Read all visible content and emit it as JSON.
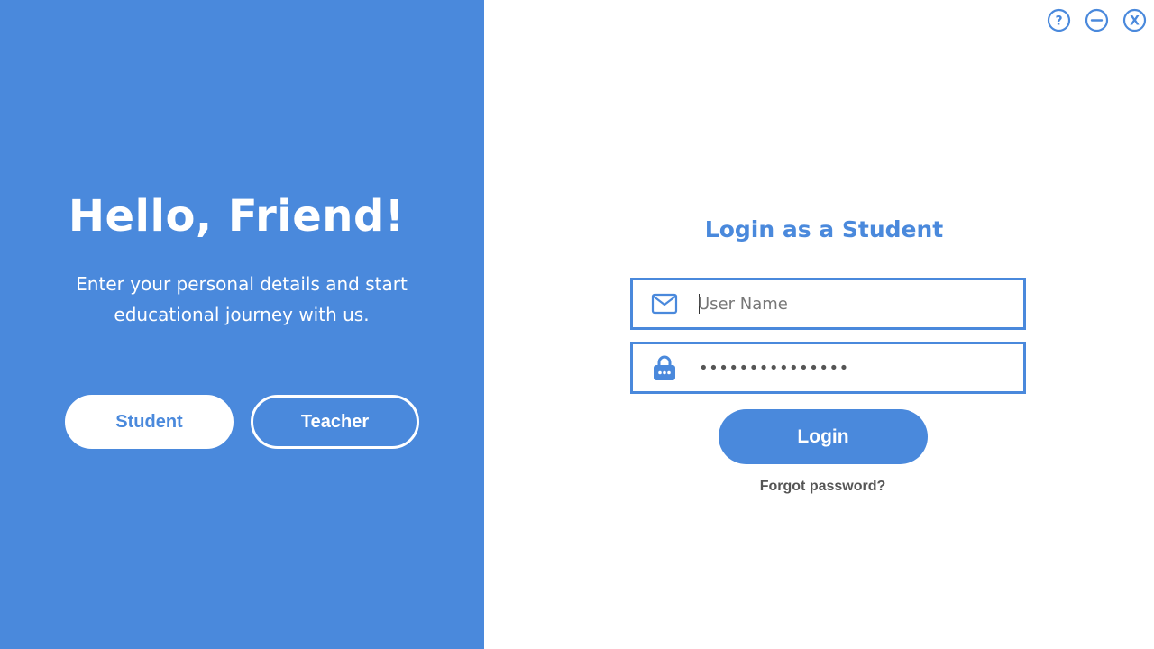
{
  "window_controls": {
    "help_glyph": "?",
    "close_glyph": "X"
  },
  "welcome": {
    "title": "Hello, Friend!",
    "subtitle": "Enter your personal details and start educational journey with us."
  },
  "roles": {
    "student_label": "Student",
    "teacher_label": "Teacher",
    "selected": "Student"
  },
  "login": {
    "title": "Login as a Student",
    "username": {
      "value": "",
      "placeholder": "User Name"
    },
    "password": {
      "masked_value": "•••••••••••••••"
    },
    "submit_label": "Login",
    "forgot_label": "Forgot password?"
  },
  "colors": {
    "accent": "#4a89dc",
    "background": "#ffffff",
    "muted_text": "#555555"
  },
  "icons": {
    "help": "help-circle-icon",
    "minimize": "minimize-circle-icon",
    "close": "close-circle-icon",
    "username": "envelope-icon",
    "password": "lock-icon"
  }
}
